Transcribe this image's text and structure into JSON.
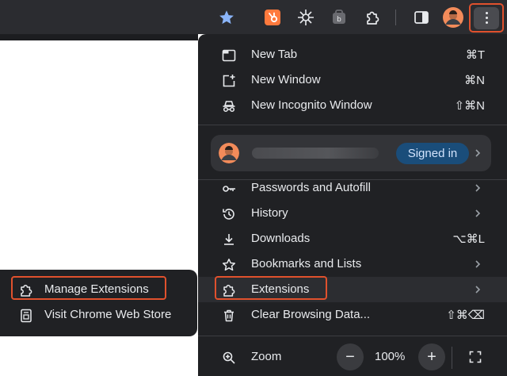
{
  "toolbar": {
    "icons": [
      "star-icon",
      "hubspot-icon",
      "sunburst-extension-icon",
      "shortcut-extension-icon",
      "puzzle-extensions-icon",
      "side-panel-icon",
      "profile-avatar",
      "more-menu-icon"
    ]
  },
  "menu": {
    "new_tab": {
      "label": "New Tab",
      "shortcut": "⌘T"
    },
    "new_window": {
      "label": "New Window",
      "shortcut": "⌘N"
    },
    "new_incognito": {
      "label": "New Incognito Window",
      "shortcut": "⇧⌘N"
    },
    "profile": {
      "status": "Signed in"
    },
    "passwords": {
      "label": "Passwords and Autofill"
    },
    "history": {
      "label": "History"
    },
    "downloads": {
      "label": "Downloads",
      "shortcut": "⌥⌘L"
    },
    "bookmarks": {
      "label": "Bookmarks and Lists"
    },
    "extensions": {
      "label": "Extensions"
    },
    "clear_data": {
      "label": "Clear Browsing Data...",
      "shortcut": "⇧⌘⌫"
    },
    "zoom": {
      "label": "Zoom",
      "minus": "−",
      "level": "100%",
      "plus": "+"
    }
  },
  "submenu": {
    "manage": {
      "label": "Manage Extensions"
    },
    "store": {
      "label": "Visit Chrome Web Store"
    }
  },
  "colors": {
    "highlight": "#e0512d",
    "menu_bg": "#202124",
    "badge_bg": "#1a4d7a"
  }
}
